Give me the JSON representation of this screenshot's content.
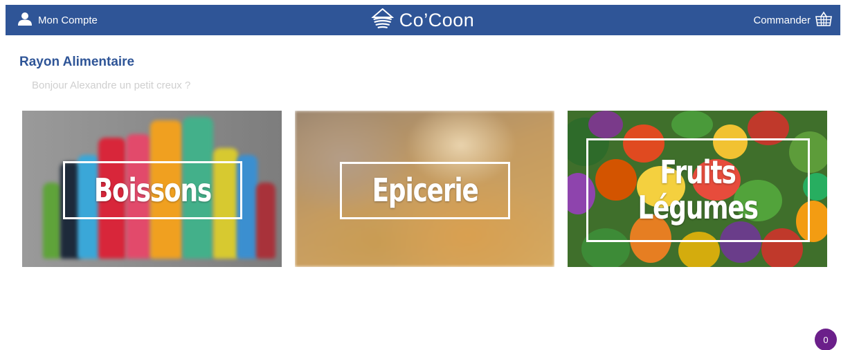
{
  "header": {
    "account_label": "Mon Compte",
    "brand_name": "Co’Coon",
    "order_label": "Commander",
    "icons": {
      "account": "user-icon",
      "brand": "cocoon-logo-icon",
      "order": "basket-icon"
    },
    "colors": {
      "bar": "#2f5597",
      "text": "#ffffff"
    }
  },
  "main": {
    "section_title": "Rayon Alimentaire",
    "greeting": "Bonjour Alexandre un petit creux ?",
    "categories": [
      {
        "label": "Boissons"
      },
      {
        "label_line1": "Epicerie"
      },
      {
        "label_line1": "Fruits",
        "label_line2": "Légumes"
      }
    ]
  },
  "cart": {
    "count": "0",
    "badge_color": "#6b1f8a"
  }
}
